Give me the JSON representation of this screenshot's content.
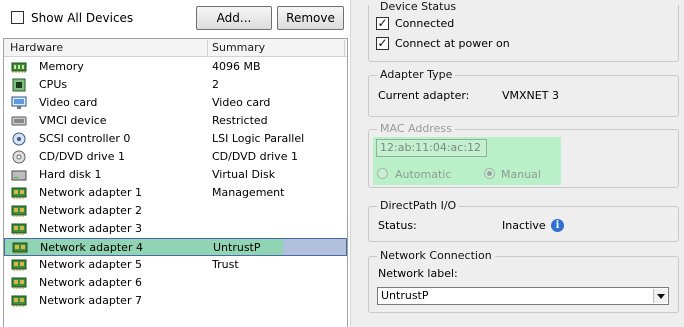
{
  "toolbar": {
    "show_all_devices_label": "Show All Devices",
    "add_label": "Add...",
    "remove_label": "Remove"
  },
  "hardware_table": {
    "columns": [
      "Hardware",
      "Summary"
    ],
    "rows": [
      {
        "icon": "memory-icon",
        "name": "Memory",
        "summary": "4096 MB"
      },
      {
        "icon": "cpu-icon",
        "name": "CPUs",
        "summary": "2"
      },
      {
        "icon": "video-card-icon",
        "name": "Video card",
        "summary": "Video card"
      },
      {
        "icon": "vmci-device-icon",
        "name": "VMCI device",
        "summary": "Restricted"
      },
      {
        "icon": "scsi-controller-icon",
        "name": "SCSI controller 0",
        "summary": "LSI Logic Parallel"
      },
      {
        "icon": "cd-dvd-drive-icon",
        "name": "CD/DVD drive 1",
        "summary": "CD/DVD drive 1"
      },
      {
        "icon": "hard-disk-icon",
        "name": "Hard disk 1",
        "summary": "Virtual Disk"
      },
      {
        "icon": "network-adapter-icon",
        "name": "Network adapter 1",
        "summary": "Management"
      },
      {
        "icon": "network-adapter-icon",
        "name": "Network adapter 2",
        "summary": ""
      },
      {
        "icon": "network-adapter-icon",
        "name": "Network adapter 3",
        "summary": ""
      },
      {
        "icon": "network-adapter-icon",
        "name": "Network adapter 4",
        "summary": "UntrustP",
        "selected": true
      },
      {
        "icon": "network-adapter-icon",
        "name": "Network adapter 5",
        "summary": "Trust"
      },
      {
        "icon": "network-adapter-icon",
        "name": "Network adapter 6",
        "summary": ""
      },
      {
        "icon": "network-adapter-icon",
        "name": "Network adapter 7",
        "summary": ""
      }
    ]
  },
  "device_status": {
    "title": "Device Status",
    "connected_label": "Connected",
    "connected_checked": true,
    "connect_at_power_on_label": "Connect at power on",
    "connect_at_power_on_checked": true
  },
  "adapter_type": {
    "title": "Adapter Type",
    "current_adapter_label": "Current adapter:",
    "current_adapter_value": "VMXNET 3"
  },
  "mac_address": {
    "title": "MAC Address",
    "value": "12:ab:11:04:ac:12",
    "automatic_label": "Automatic",
    "manual_label": "Manual",
    "selected": "Manual"
  },
  "directpath": {
    "title": "DirectPath I/O",
    "status_label": "Status:",
    "status_value": "Inactive"
  },
  "network_connection": {
    "title": "Network Connection",
    "network_label_label": "Network label:",
    "network_label_value": "UntrustP"
  },
  "colors": {
    "selection_highlight": "#90d4b3",
    "selection_row": "#b0c0dd",
    "mac_highlight": "#b9f0c8",
    "info_icon": "#2e6fd1"
  }
}
